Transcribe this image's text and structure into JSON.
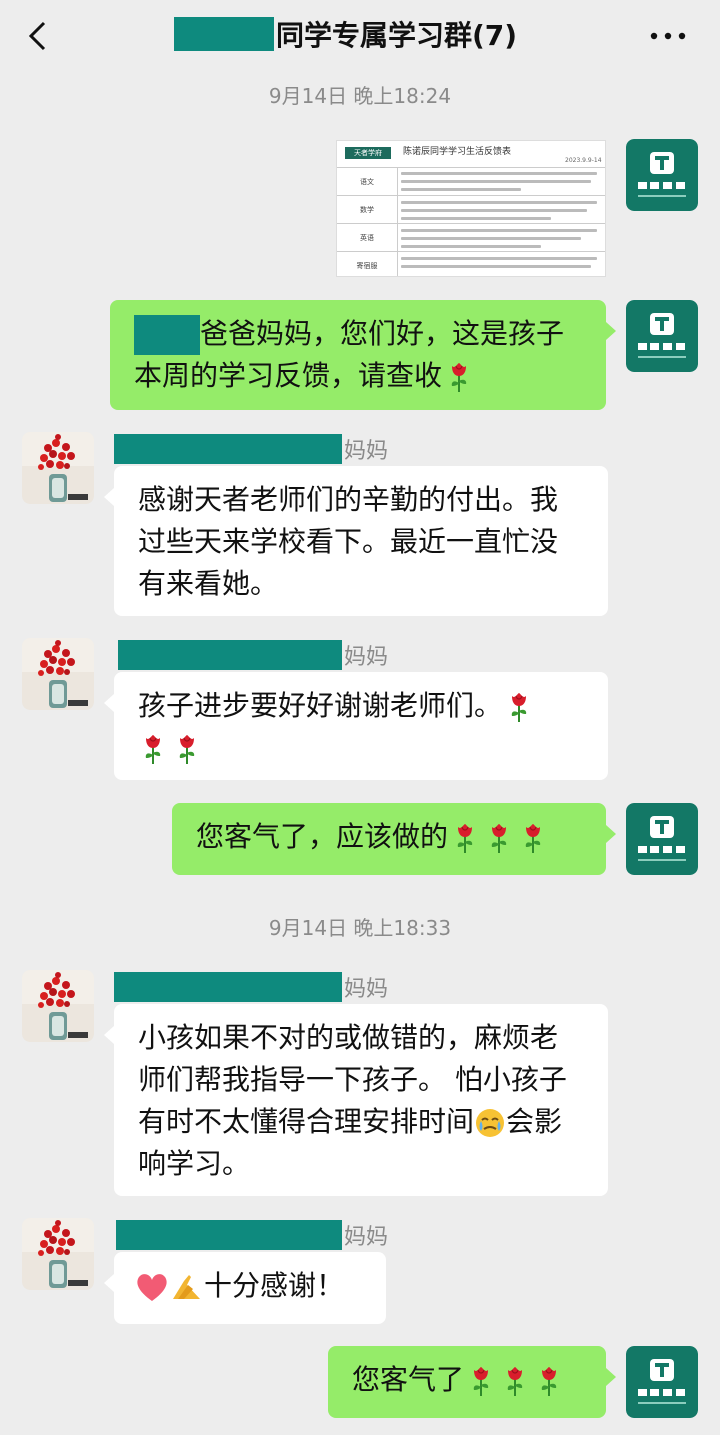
{
  "header": {
    "title_suffix": "同学专属学习群(7)",
    "back_icon": "chevron-left-icon",
    "more_icon": "more-dots-icon"
  },
  "timestamps": [
    "9月14日 晚上18:24",
    "9月14日 晚上18:33"
  ],
  "document_card": {
    "title": "陈诺辰同学学习生活反馈表",
    "logo_text": "天者学府",
    "date": "2023.9.9-14",
    "row_labels": [
      "语文",
      "数学",
      "英语",
      "寄宿服"
    ]
  },
  "messages": {
    "m1": {
      "text": "爸爸妈妈，您们好，这是孩子本周的学习反馈，请查收"
    },
    "m2": {
      "sender_suffix": "妈妈",
      "text": "感谢天者老师们的辛勤的付出。我过些天来学校看下。最近一直忙没有来看她。"
    },
    "m3": {
      "sender_suffix": "妈妈",
      "text": "孩子进步要好好谢谢老师们。"
    },
    "m4": {
      "text": "您客气了，应该做的"
    },
    "m5": {
      "sender_suffix": "妈妈",
      "text_a": "小孩如果不对的或做错的，麻烦老师们帮我指导一下孩子。 怕小孩子有时不太懂得合理安排时间",
      "text_b": "会影响学习。"
    },
    "m6": {
      "sender_suffix": "妈妈",
      "text": "十分感谢！"
    },
    "m7": {
      "text": "您客气了"
    }
  },
  "colors": {
    "background": "#ededed",
    "outgoing_bubble": "#95ec69",
    "incoming_bubble": "#ffffff",
    "mask": "#0e8a7e",
    "brand_avatar": "#137866"
  }
}
